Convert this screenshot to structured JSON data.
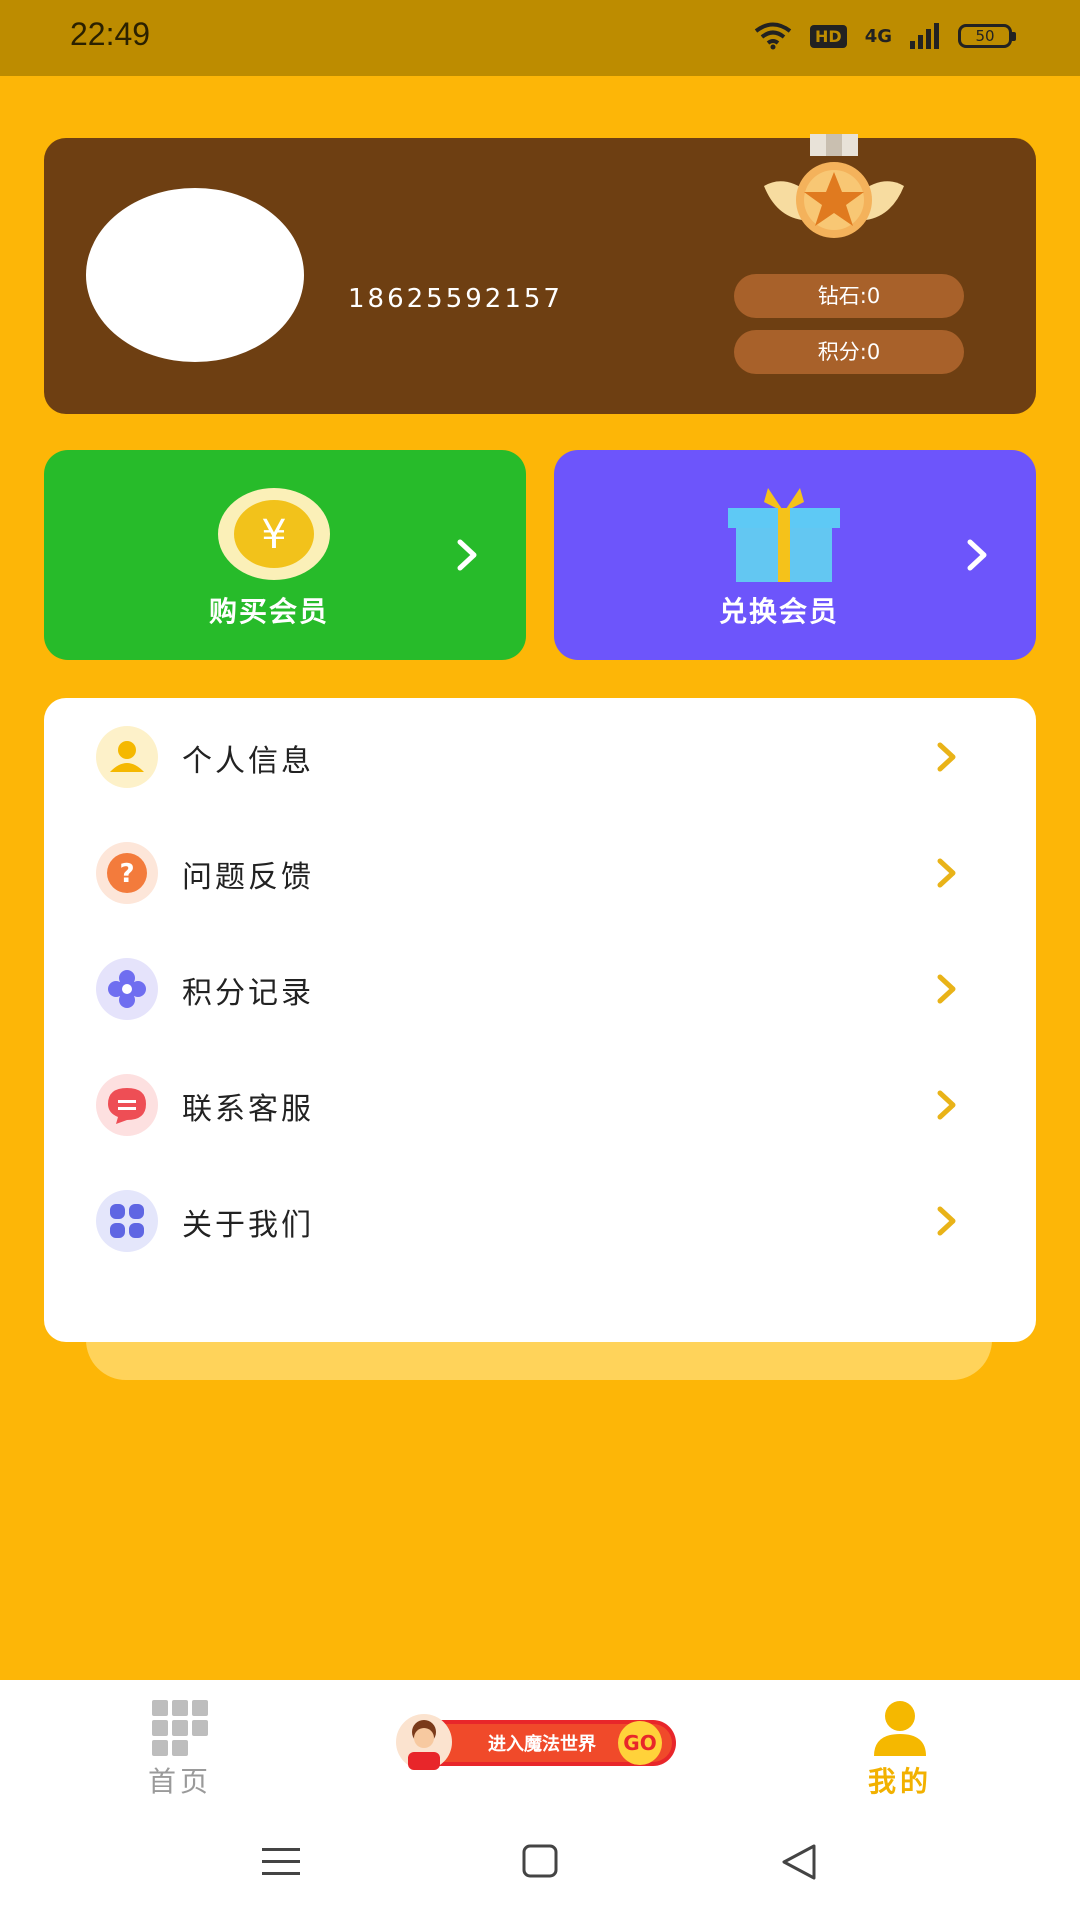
{
  "status_bar": {
    "time": "22:49",
    "network": "HD",
    "signal": "4G",
    "battery": "50"
  },
  "profile": {
    "phone": "18625592157",
    "diamond": "钻石:0",
    "points": "积分:0"
  },
  "actions": {
    "buy_label": "购买会员",
    "redeem_label": "兑换会员"
  },
  "menu": {
    "items": [
      {
        "label": "个人信息",
        "icon": "user-icon"
      },
      {
        "label": "问题反馈",
        "icon": "question-icon"
      },
      {
        "label": "积分记录",
        "icon": "flower-icon"
      },
      {
        "label": "联系客服",
        "icon": "chat-icon"
      },
      {
        "label": "关于我们",
        "icon": "grid-icon"
      }
    ]
  },
  "tabbar": {
    "home_label": "首页",
    "promo_text": "进入魔法世界",
    "promo_go": "GO",
    "mine_label": "我的"
  },
  "colors": {
    "background": "#fdb607",
    "profile_card": "#6e3f12",
    "buy_card": "#27bb2a",
    "redeem_card": "#6d55fb",
    "accent": "#f2b100"
  }
}
